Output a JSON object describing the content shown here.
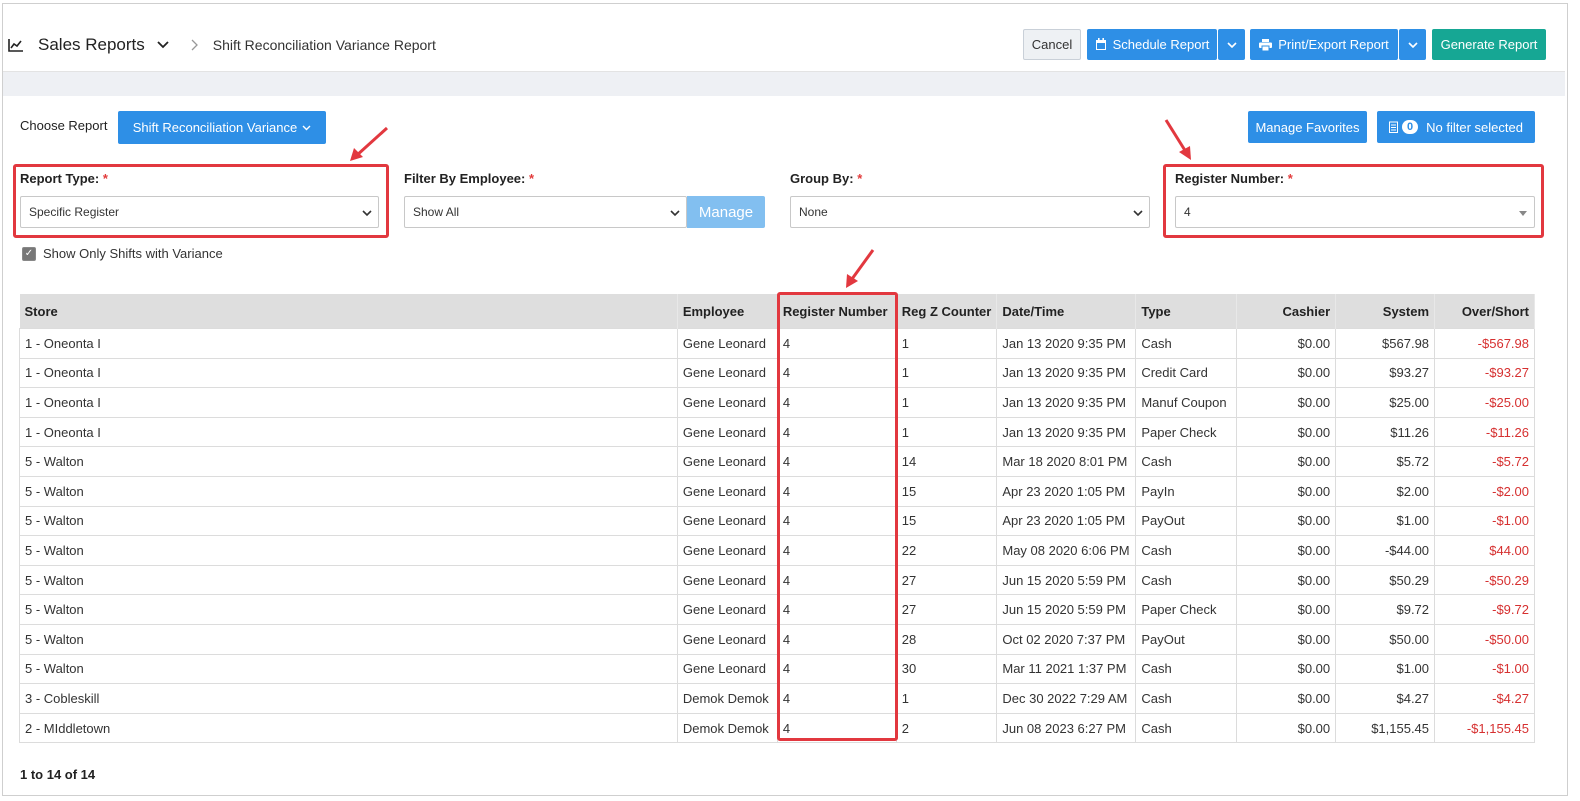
{
  "header": {
    "section_title": "Sales Reports",
    "breadcrumb_sub": "Shift Reconciliation Variance Report",
    "cancel_label": "Cancel",
    "schedule_label": "Schedule Report",
    "print_label": "Print/Export Report",
    "generate_label": "Generate Report"
  },
  "controls": {
    "choose_label": "Choose Report",
    "choose_value": "Shift Reconciliation Variance",
    "favorites_label": "Manage Favorites",
    "filter_count": "0",
    "filter_label": "No filter selected"
  },
  "filters": {
    "report_type": {
      "label": "Report Type:",
      "required": "*",
      "value": "Specific Register"
    },
    "employee": {
      "label": "Filter By Employee:",
      "required": "*",
      "value": "Show All",
      "manage_label": "Manage"
    },
    "group_by": {
      "label": "Group By:",
      "required": "*",
      "value": "None"
    },
    "register": {
      "label": "Register Number:",
      "required": "*",
      "value": "4"
    },
    "variance_checkbox": {
      "label": "Show Only Shifts with Variance",
      "checked": true
    }
  },
  "table": {
    "columns": [
      "Store",
      "Employee",
      "Register Number",
      "Reg Z Counter",
      "Date/Time",
      "Type",
      "Cashier",
      "System",
      "Over/Short"
    ],
    "rows": [
      [
        "1 - Oneonta I",
        "Gene Leonard",
        "4",
        "1",
        "Jan 13 2020 9:35 PM",
        "Cash",
        "$0.00",
        "$567.98",
        "-$567.98"
      ],
      [
        "1 - Oneonta I",
        "Gene Leonard",
        "4",
        "1",
        "Jan 13 2020 9:35 PM",
        "Credit Card",
        "$0.00",
        "$93.27",
        "-$93.27"
      ],
      [
        "1 - Oneonta I",
        "Gene Leonard",
        "4",
        "1",
        "Jan 13 2020 9:35 PM",
        "Manuf Coupon",
        "$0.00",
        "$25.00",
        "-$25.00"
      ],
      [
        "1 - Oneonta I",
        "Gene Leonard",
        "4",
        "1",
        "Jan 13 2020 9:35 PM",
        "Paper Check",
        "$0.00",
        "$11.26",
        "-$11.26"
      ],
      [
        "5 - Walton",
        "Gene Leonard",
        "4",
        "14",
        "Mar 18 2020 8:01 PM",
        "Cash",
        "$0.00",
        "$5.72",
        "-$5.72"
      ],
      [
        "5 - Walton",
        "Gene Leonard",
        "4",
        "15",
        "Apr 23 2020 1:05 PM",
        "PayIn",
        "$0.00",
        "$2.00",
        "-$2.00"
      ],
      [
        "5 - Walton",
        "Gene Leonard",
        "4",
        "15",
        "Apr 23 2020 1:05 PM",
        "PayOut",
        "$0.00",
        "$1.00",
        "-$1.00"
      ],
      [
        "5 - Walton",
        "Gene Leonard",
        "4",
        "22",
        "May 08 2020 6:06 PM",
        "Cash",
        "$0.00",
        "-$44.00",
        "$44.00"
      ],
      [
        "5 - Walton",
        "Gene Leonard",
        "4",
        "27",
        "Jun 15 2020 5:59 PM",
        "Cash",
        "$0.00",
        "$50.29",
        "-$50.29"
      ],
      [
        "5 - Walton",
        "Gene Leonard",
        "4",
        "27",
        "Jun 15 2020 5:59 PM",
        "Paper Check",
        "$0.00",
        "$9.72",
        "-$9.72"
      ],
      [
        "5 - Walton",
        "Gene Leonard",
        "4",
        "28",
        "Oct 02 2020 7:37 PM",
        "PayOut",
        "$0.00",
        "$50.00",
        "-$50.00"
      ],
      [
        "5 - Walton",
        "Gene Leonard",
        "4",
        "30",
        "Mar 11 2021 1:37 PM",
        "Cash",
        "$0.00",
        "$1.00",
        "-$1.00"
      ],
      [
        "3 - Cobleskill",
        "Demok Demok",
        "4",
        "1",
        "Dec 30 2022 7:29 AM",
        "Cash",
        "$0.00",
        "$4.27",
        "-$4.27"
      ],
      [
        "2 - MIddletown",
        "Demok Demok",
        "4",
        "2",
        "Jun 08 2023 6:27 PM",
        "Cash",
        "$0.00",
        "$1,155.45",
        "-$1,155.45"
      ]
    ],
    "pagination": "1 to 14 of 14"
  },
  "colors": {
    "primary": "#2e8fe6",
    "generate": "#16a794",
    "negative": "#d63030",
    "annotation": "#e2383f"
  }
}
